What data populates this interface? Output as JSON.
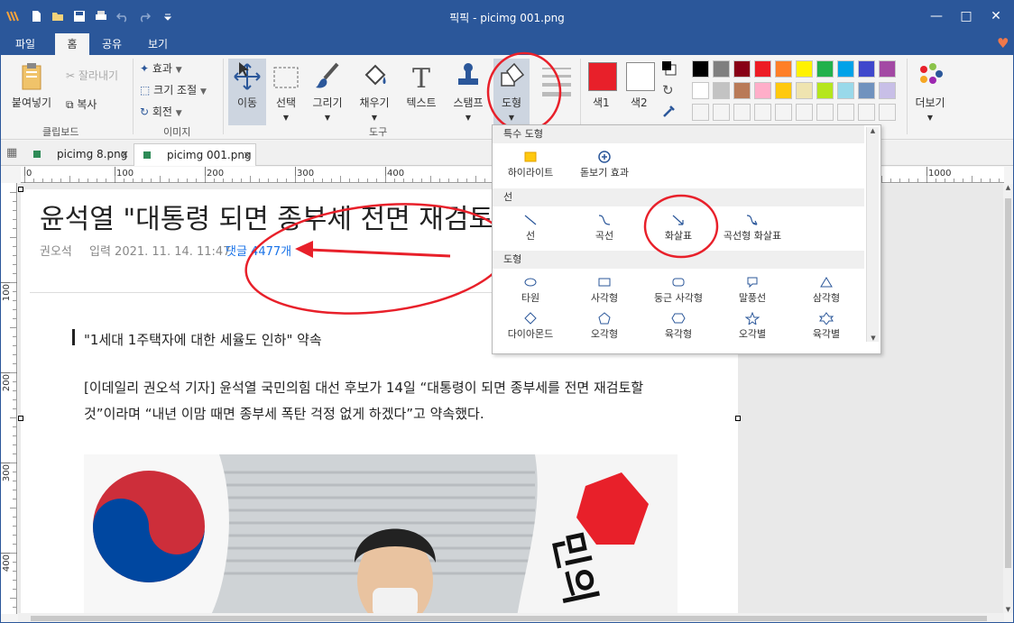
{
  "window": {
    "title": "픽픽 - picimg 001.png"
  },
  "menu_tabs": [
    "파일",
    "홈",
    "공유",
    "보기"
  ],
  "ribbon": {
    "clipboard": {
      "paste": "붙여넣기",
      "cut": "잘라내기",
      "copy": "복사",
      "group": "클립보드"
    },
    "image": {
      "effect": "효과",
      "resize": "크기 조절",
      "rotate": "회전",
      "group": "이미지"
    },
    "tools": {
      "move": "이동",
      "select": "선택",
      "draw": "그리기",
      "fill": "채우기",
      "text": "텍스트",
      "stamp": "스탬프",
      "shape": "도형",
      "group": "도구"
    },
    "colors": {
      "color1": "색1",
      "color2": "색2",
      "more": "더보기"
    },
    "palette": [
      "#000000",
      "#7f7f7f",
      "#880015",
      "#ed1c24",
      "#ff7f27",
      "#fff200",
      "#22b14c",
      "#00a2e8",
      "#3f48cc",
      "#a349a4",
      "#ffffff",
      "#c3c3c3",
      "#b97a57",
      "#ffaec9",
      "#ffc90e",
      "#efe4b0",
      "#b5e61d",
      "#99d9ea",
      "#7092be",
      "#c8bfe7"
    ]
  },
  "doc_tabs": [
    "picimg 8.png",
    "picimg 001.png"
  ],
  "ruler_h": [
    "0",
    "100",
    "200",
    "300",
    "400",
    "1000"
  ],
  "ruler_v": [
    "100",
    "200",
    "300",
    "400"
  ],
  "article": {
    "headline": "윤석열 \"대통령 되면 종부세 전면 재검토",
    "author": "권오석",
    "date": "입력 2021. 11. 14. 11:47",
    "comments": "댓글 4477개",
    "quote": "\"1세대 1주택자에 대한 세율도 인하\" 약속",
    "body": "[이데일리 권오석 기자] 윤석열 국민의힘 대선 후보가 14일 “대통령이 되면 종부세를 전면 재검토할 것”이라며 “내년 이맘 때면 종부세 폭탄 걱정 없게 하겠다”고 약속했다."
  },
  "dropdown": {
    "special_title": "특수 도형",
    "highlight": "하이라이트",
    "magnify": "돋보기 효과",
    "lines_title": "선",
    "line": "선",
    "curve": "곡선",
    "arrow": "화살표",
    "curved_arrow": "곡선형 화살표",
    "shapes_title": "도형",
    "ellipse": "타원",
    "rectangle": "사각형",
    "rounded_rect": "둥근 사각형",
    "balloon": "말풍선",
    "triangle": "삼각형",
    "diamond": "다이아몬드",
    "pentagon": "오각형",
    "hexagon": "육각형",
    "pentagram": "오각별",
    "hexagram": "육각별"
  },
  "colors": {
    "accent": "#2b579a",
    "annotation": "#e8202a",
    "link": "#1a73e8"
  }
}
